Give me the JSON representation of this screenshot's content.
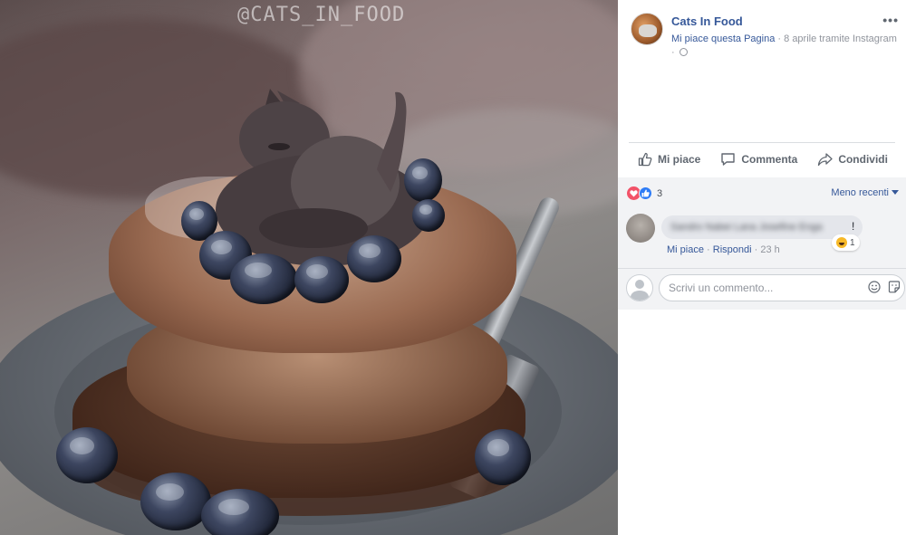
{
  "photo": {
    "watermark": "@CATS_IN_FOOD",
    "alt": "Cat sitting on a stack of French toast with blueberries"
  },
  "post": {
    "page_name": "Cats In Food",
    "liked_label": "Mi piace questa Pagina",
    "separator": " · ",
    "timestamp": "8 aprile tramite Instagram",
    "more_label": "•••"
  },
  "actions": {
    "like": "Mi piace",
    "comment": "Commenta",
    "share": "Condividi"
  },
  "reactions": {
    "count": "3",
    "sort_label": "Meno recenti"
  },
  "comment": {
    "author_blurred": "Sandro Nabei Lana Josefine Enga",
    "text_end": "!",
    "reaction_count": "1",
    "like_link": "Mi piace",
    "reply_link": "Rispondi",
    "time": "23 h"
  },
  "composer": {
    "placeholder": "Scrivi un commento..."
  },
  "colors": {
    "link": "#365899",
    "meta": "#90949c",
    "comment_bg": "#f2f3f5"
  }
}
